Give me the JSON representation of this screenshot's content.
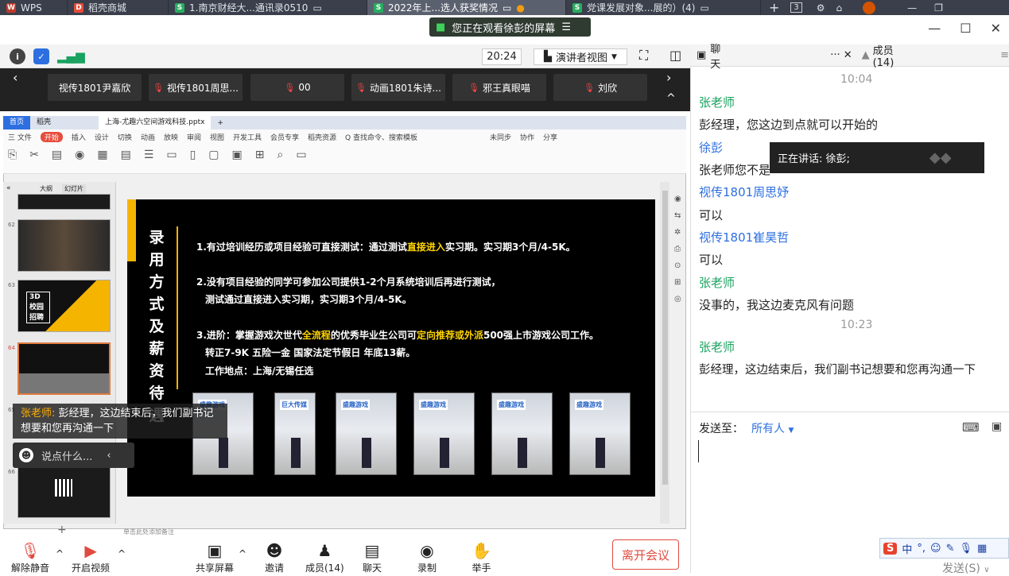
{
  "taskbar": {
    "tabs": [
      {
        "label": "WPS",
        "icon": "wps-logo-icon",
        "color": "#c0392b"
      },
      {
        "label": "稻壳商城",
        "icon": "docer-icon",
        "color": "#e74c3c"
      },
      {
        "label": "1.南京财经大...通讯录0510",
        "icon": "sheet-icon",
        "color": "#27ae60"
      },
      {
        "label": "2022年上...选人获奖情况",
        "icon": "sheet-icon",
        "color": "#27ae60"
      },
      {
        "label": "党课发展对象...展的）(4)",
        "icon": "sheet-icon",
        "color": "#27ae60"
      }
    ],
    "tab_count": "3"
  },
  "banner": {
    "text": "您正在观看徐彭的屏幕"
  },
  "toolbar": {
    "time": "20:24",
    "view_label": "演讲者视图"
  },
  "participants": [
    "视传1801尹嘉欣",
    "视传1801周思...",
    "00",
    "动画1801朱诗...",
    "邪王真眼喵",
    "刘欣"
  ],
  "wps": {
    "home_tab": "首页",
    "docer_tab": "稻壳",
    "file_tab": "上海-尤趣六空间游戏科技.pptx",
    "menu": [
      "三 文件",
      "开始",
      "插入",
      "设计",
      "切换",
      "动画",
      "放映",
      "审阅",
      "视图",
      "开发工具",
      "会员专享",
      "稻壳资源",
      "Q 查找命令、搜索模板"
    ],
    "menu_right": [
      "未同步",
      "协作",
      "分享"
    ],
    "sidebar_tabs": [
      "大纲",
      "幻灯片"
    ],
    "slide_numbers": [
      "62",
      "63",
      "64",
      "65",
      "66"
    ],
    "thumb_label": "3D 校园 招聘",
    "notes_placeholder": "单击此处添加备注"
  },
  "slide": {
    "vertical_title": "录用方式及薪资待遇",
    "lines": [
      {
        "a": "1.有过培训经历或项目经验可直接测试：通过测试",
        "h": "直接进入",
        "b": "实习期。实习期3个月/4-5K。"
      },
      {
        "a": "2.没有项目经验的同学可参加公司提供1-2个月系统培训后再进行测试，",
        "h": "",
        "b": ""
      },
      {
        "a": "测试通过直接进入实习期，实习期3个月/4-5K。",
        "h": "",
        "b": ""
      },
      {
        "a": "3.进阶：掌握游戏次世代",
        "h": "全流程",
        "b": "的优秀毕业生公司可"
      },
      {
        "a": "转正7-9K  五险一金  国家法定节假日  年底13薪。",
        "h": "",
        "b": ""
      },
      {
        "a": "工作地点：上海/无锡任选",
        "h": "",
        "b": ""
      }
    ],
    "line4_highlight2": "定向推荐或外派",
    "line4_tail": "500强上市游戏公司工作。",
    "photo_logos": [
      "盛趣游戏",
      "巨大传媒",
      "盛趣游戏",
      "盛趣游戏",
      "盛趣游戏",
      "盛趣游戏",
      "盛趣游戏"
    ]
  },
  "popover": {
    "sender": "张老师:",
    "text": "彭经理，这边结束后，我们副书记想要和您再沟通一下"
  },
  "saybar": {
    "placeholder": "说点什么..."
  },
  "chat": {
    "tab_chat": "聊天",
    "tab_members": "成员(14)",
    "messages": [
      {
        "type": "time",
        "text": "10:04"
      },
      {
        "type": "name",
        "text": "张老师"
      },
      {
        "type": "text",
        "text": "彭经理，您这边到点就可以开始的"
      },
      {
        "type": "name",
        "text": "徐彭"
      },
      {
        "type": "text",
        "text": "张老师您不是"
      },
      {
        "type": "name",
        "text": "视传1801周思妤"
      },
      {
        "type": "text",
        "text": "可以"
      },
      {
        "type": "name",
        "text": "视传1801崔昊哲"
      },
      {
        "type": "text",
        "text": "可以"
      },
      {
        "type": "name",
        "text": "张老师"
      },
      {
        "type": "text",
        "text": "没事的，我这边麦克风有问题"
      },
      {
        "type": "time",
        "text": "10:23"
      },
      {
        "type": "name",
        "text": "张老师"
      },
      {
        "type": "text",
        "text": "彭经理，这边结束后，我们副书记想要和您再沟通一下"
      }
    ],
    "speaking": "正在讲话: 徐彭;",
    "send_to_label": "发送至：",
    "send_to_value": "所有人",
    "send_button": "发送(S)"
  },
  "bottom": {
    "items": [
      {
        "label": "解除静音",
        "icon": "mic-muted-icon"
      },
      {
        "label": "开启视频",
        "icon": "video-off-icon"
      },
      {
        "label": "共享屏幕",
        "icon": "share-screen-icon"
      },
      {
        "label": "邀请",
        "icon": "invite-icon"
      },
      {
        "label": "成员(14)",
        "icon": "members-icon"
      },
      {
        "label": "聊天",
        "icon": "chat-icon"
      },
      {
        "label": "录制",
        "icon": "record-icon"
      },
      {
        "label": "举手",
        "icon": "raise-hand-icon"
      }
    ],
    "leave": "离开会议"
  },
  "ime": {
    "mode": "中"
  }
}
